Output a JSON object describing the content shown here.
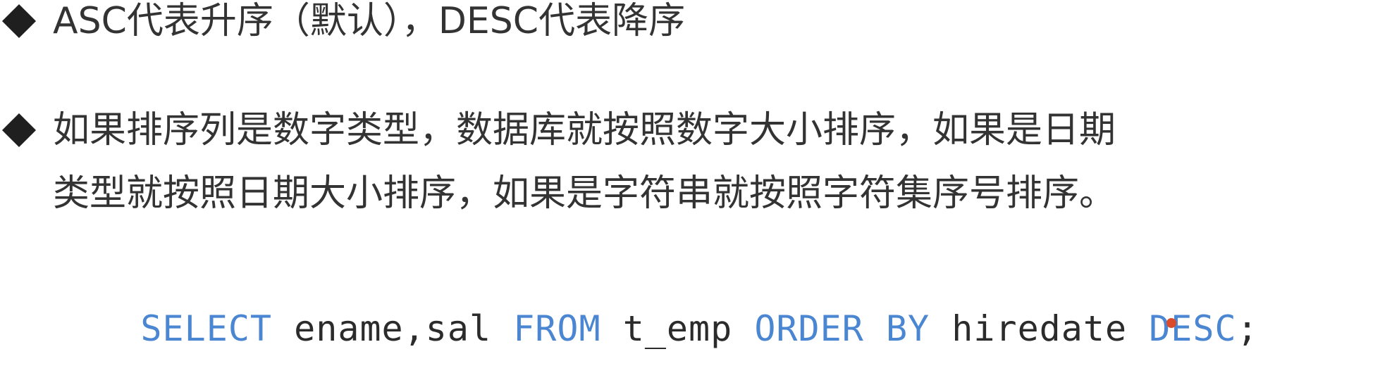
{
  "bullets": [
    {
      "lines": [
        "ASC代表升序（默认），DESC代表降序"
      ]
    },
    {
      "lines": [
        "如果排序列是数字类型，数据库就按照数字大小排序，如果是日期",
        "类型就按照日期大小排序，如果是字符串就按照字符集序号排序。"
      ]
    }
  ],
  "code": {
    "tokens": [
      {
        "text": "SELECT",
        "kind": "keyword"
      },
      {
        "text": " ename,sal ",
        "kind": "plain"
      },
      {
        "text": "FROM",
        "kind": "keyword"
      },
      {
        "text": " t_emp ",
        "kind": "plain"
      },
      {
        "text": "ORDER BY",
        "kind": "keyword"
      },
      {
        "text": " hiredate ",
        "kind": "plain"
      },
      {
        "text": "DESC",
        "kind": "keyword"
      },
      {
        "text": ";",
        "kind": "plain"
      }
    ]
  },
  "colors": {
    "keyword": "#4a86d1",
    "text": "#333333",
    "bullet": "#1f1f1f",
    "cursor": "#d94b2b"
  },
  "icons": {
    "bullet_icon": "diamond-bullet-icon",
    "pointer_icon": "red-pointer-dot-icon"
  }
}
